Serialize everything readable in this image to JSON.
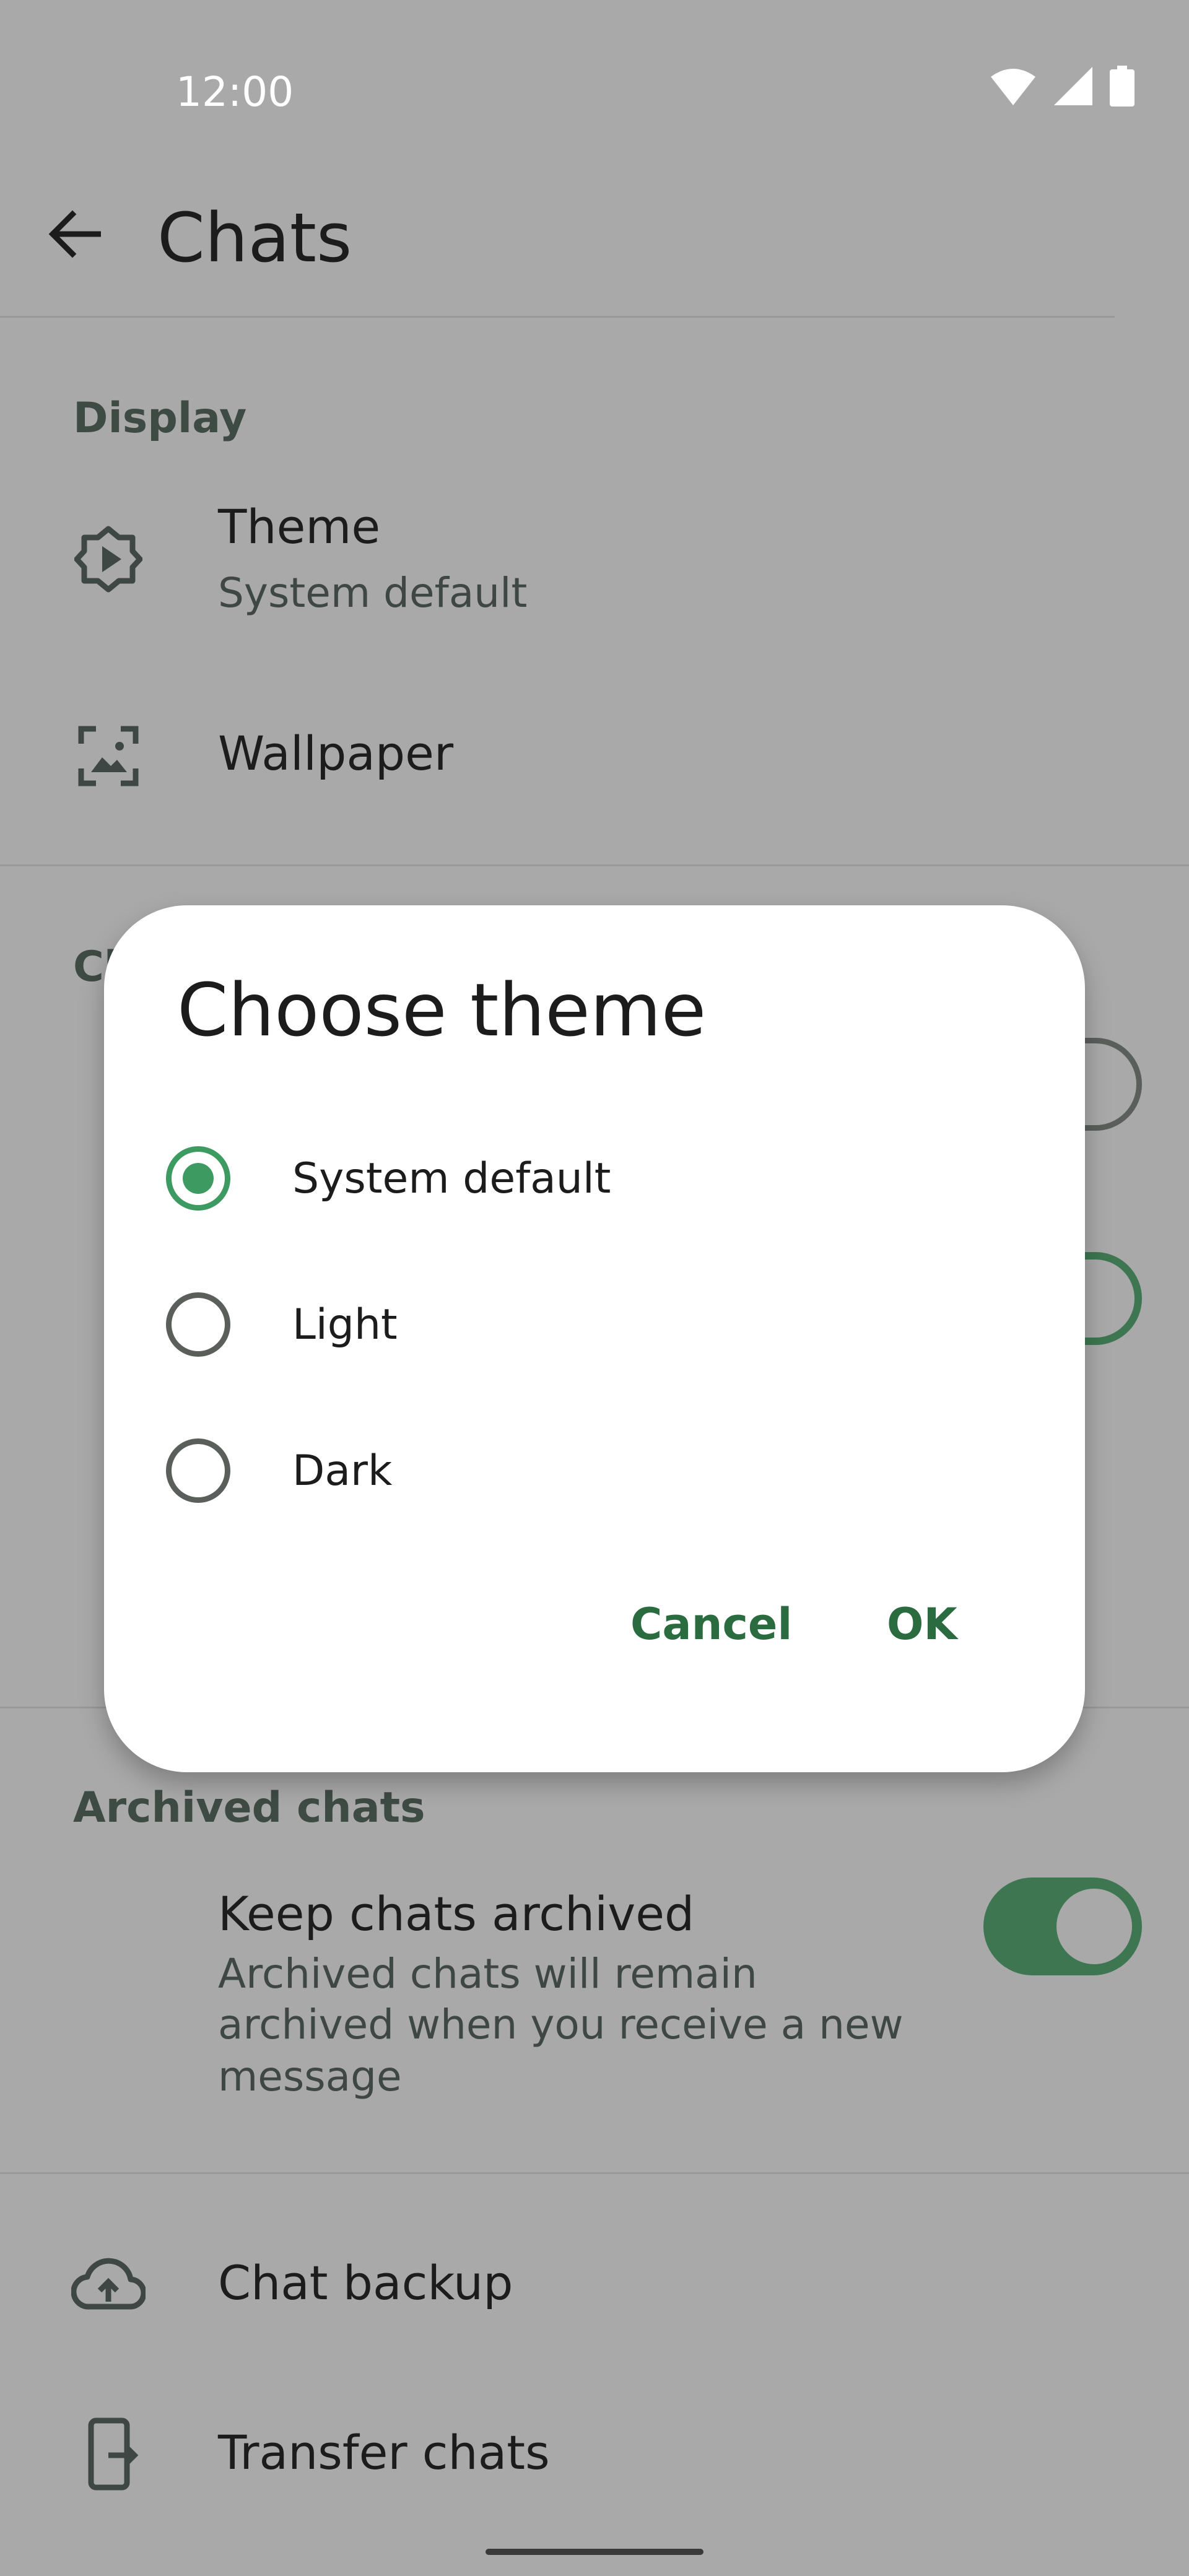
{
  "status_bar": {
    "time": "12:00"
  },
  "app_bar": {
    "title": "Chats"
  },
  "display_section": {
    "header": "Display",
    "theme": {
      "title": "Theme",
      "subtitle": "System default"
    },
    "wallpaper": {
      "title": "Wallpaper"
    }
  },
  "chat_settings_section": {
    "header_partial": "Cl"
  },
  "archived_section": {
    "header": "Archived chats",
    "keep_archived": {
      "title": "Keep chats archived",
      "subtitle_lines": [
        "Archived chats will remain",
        "archived when you receive a new",
        "message"
      ],
      "enabled": true
    }
  },
  "misc": {
    "chat_backup": "Chat backup",
    "transfer_chats": "Transfer chats"
  },
  "dialog": {
    "title": "Choose theme",
    "options": [
      {
        "label": "System default",
        "selected": true
      },
      {
        "label": "Light",
        "selected": false
      },
      {
        "label": "Dark",
        "selected": false
      }
    ],
    "cancel_label": "Cancel",
    "ok_label": "OK"
  },
  "colors": {
    "accent": "#3d9b62",
    "button_text": "#2b6b40",
    "scrim_background": "#a9a9a9"
  }
}
